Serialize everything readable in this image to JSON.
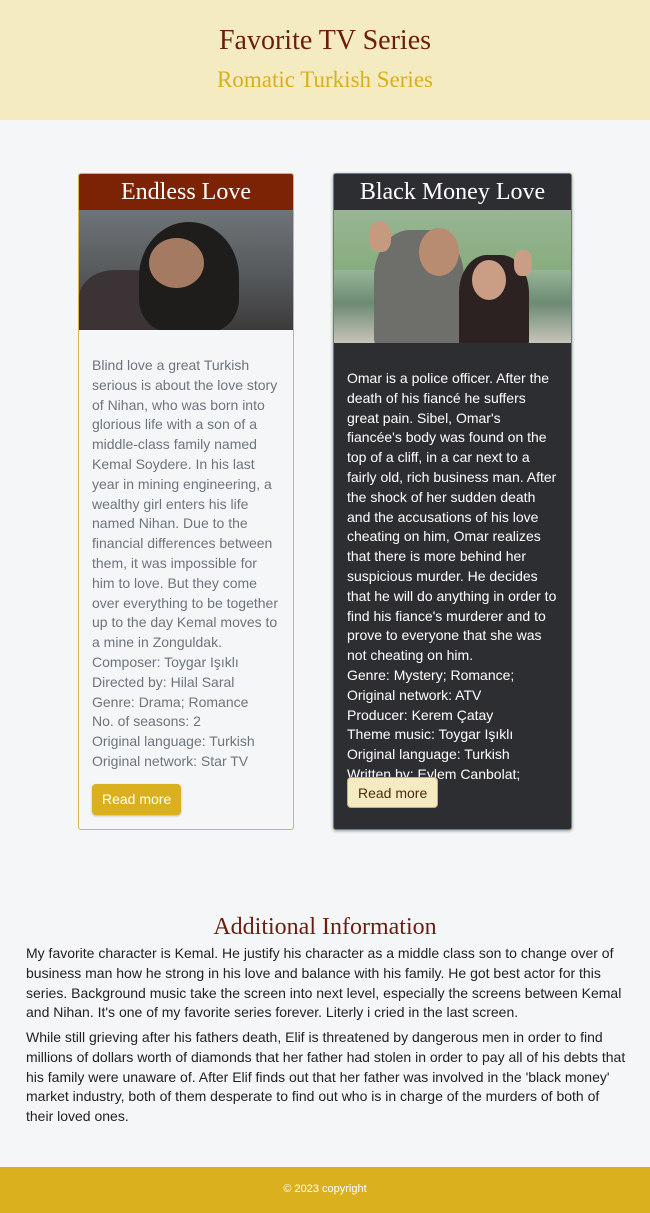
{
  "header": {
    "title": "Favorite TV Series",
    "subtitle": "Romatic Turkish Series"
  },
  "cards": [
    {
      "title": "Endless Love",
      "image_alt": "Couple embracing",
      "paragraph": "Blind love a great Turkish serious is about the love story of Nihan, who was born into glorious life with a son of a middle-class family named Kemal Soydere. In his last year in mining engineering, a wealthy girl enters his life named Nihan. Due to the financial differences between them, it was impossible for him to love. But they come over everything to be together up to the day Kemal moves to a mine in Zonguldak.",
      "details": [
        "Composer: Toygar Işıklı",
        "Directed by: Hilal Saral",
        "Genre: Drama; Romance",
        "No. of seasons: 2",
        "Original language: Turkish",
        "Original network: Star TV"
      ],
      "button": "Read more"
    },
    {
      "title": "Black Money Love",
      "image_alt": "Couple waving",
      "paragraph": "Omar is a police officer. After the death of his fiancé he suffers great pain. Sibel, Omar's fiancée's body was found on the top of a cliff, in a car next to a fairly old, rich business man. After the shock of her sudden death and the accusations of his love cheating on him, Omar realizes that there is more behind her suspicious murder. He decides that he will do anything in order to find his fiance's murderer and to prove to everyone that she was not cheating on him.",
      "details": [
        "Genre: Mystery; Romance;",
        "Original network: ATV",
        "Producer: Kerem Çatay",
        "Theme music: Toygar Işıklı",
        "Original language: Turkish",
        "Written by: Eylem Canbolat;"
      ],
      "button": "Read more"
    }
  ],
  "additional": {
    "title": "Additional Information",
    "paragraphs": [
      "My favorite character is Kemal. He justify his character as a middle class son to change over of business man how he strong in his love and balance with his family. He got best actor for this series. Background music take the screen into next level, especially the screens between Kemal and Nihan. It's one of my favorite series forever. Literly i cried in the last screen.",
      "While still grieving after his fathers death, Elif is threatened by dangerous men in order to find millions of dollars worth of diamonds that her father had stolen in order to pay all of his debts that his family were unaware of. After Elif finds out that her father was involved in the 'black money' market industry, both of them desperate to find out who is in charge of the murders of both of their loved ones."
    ]
  },
  "footer": {
    "copyright": "© 2023 copyright"
  }
}
